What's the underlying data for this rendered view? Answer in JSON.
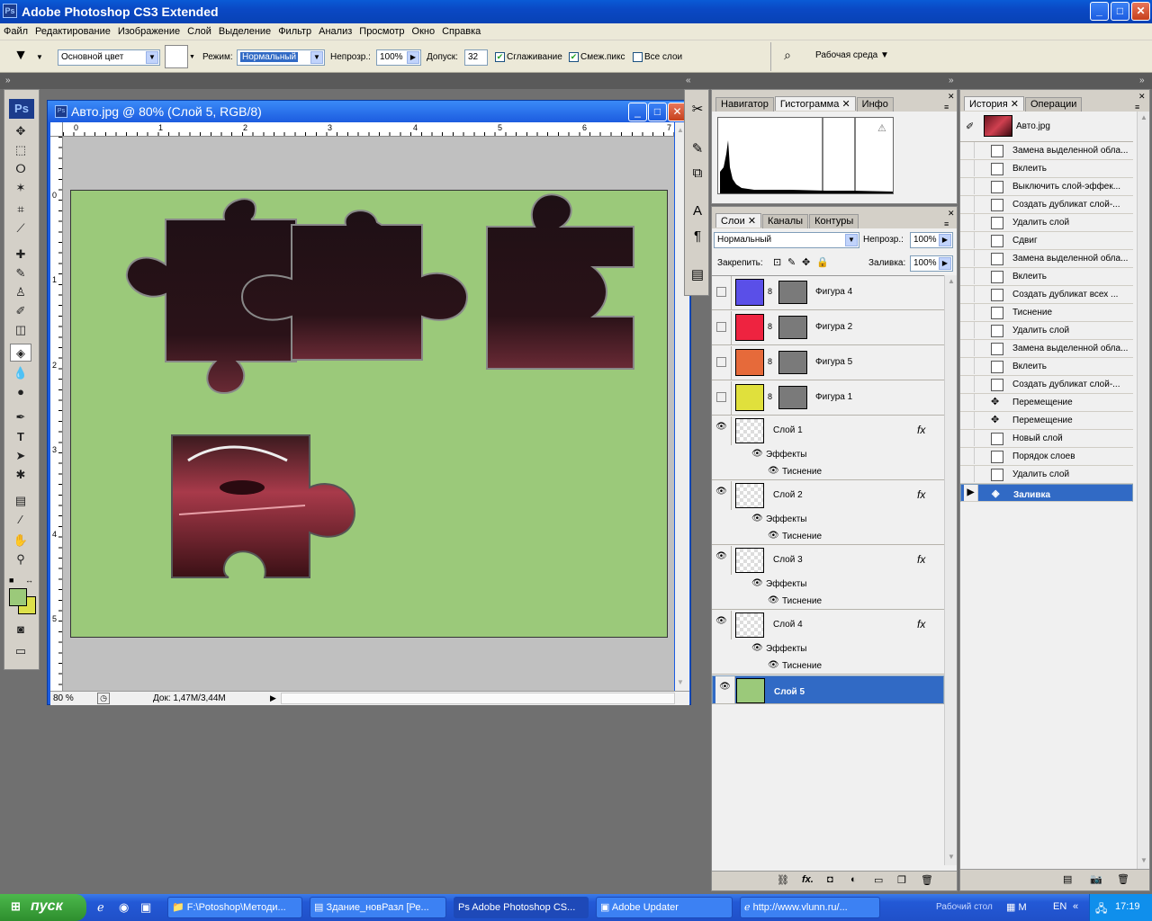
{
  "app": {
    "title": "Adobe Photoshop CS3 Extended",
    "ps_badge": "Ps"
  },
  "window_buttons": {
    "minimize": "_",
    "maximize": "□",
    "close": "✕"
  },
  "menu": [
    "Файл",
    "Редактирование",
    "Изображение",
    "Слой",
    "Выделение",
    "Фильтр",
    "Анализ",
    "Просмотр",
    "Окно",
    "Справка"
  ],
  "options": {
    "fill_source": "Основной цвет",
    "mode_label": "Режим:",
    "mode_value": "Нормальный",
    "opacity_label": "Непрозр.:",
    "opacity_value": "100%",
    "tolerance_label": "Допуск:",
    "tolerance_value": "32",
    "antialias_label": "Сглаживание",
    "contiguous_label": "Смеж.пикс",
    "all_layers_label": "Все слои",
    "workspace_label": "Рабочая среда"
  },
  "document": {
    "title": "Авто.jpg @ 80% (Слой 5, RGB/8)",
    "zoom": "80 %",
    "doc_info": "Док: 1,47M/3,44M",
    "ruler_top": [
      "0",
      "1",
      "2",
      "3",
      "4",
      "5",
      "6",
      "7"
    ],
    "ruler_left": [
      "0",
      "1",
      "2",
      "3",
      "4",
      "5"
    ],
    "canvas_color": "#9bc97a"
  },
  "navigator": {
    "tabs": [
      "Навигатор",
      "Гистограмма",
      "Инфо"
    ],
    "active_tab": "Гистограмма"
  },
  "layers_panel": {
    "tabs": [
      "Слои",
      "Каналы",
      "Контуры"
    ],
    "blend_mode": "Нормальный",
    "opacity_label": "Непрозр.:",
    "opacity_value": "100%",
    "lock_label": "Закрепить:",
    "fill_label": "Заливка:",
    "fill_value": "100%",
    "fx_label": "fx",
    "effects_label": "Эффекты",
    "emboss_label": "Тиснение",
    "shapes": [
      {
        "name": "Фигура 4",
        "color": "#5a4fe8"
      },
      {
        "name": "Фигура 2",
        "color": "#ee2340"
      },
      {
        "name": "Фигура 5",
        "color": "#e66a3a"
      },
      {
        "name": "Фигура 1",
        "color": "#e0e03c"
      }
    ],
    "layers": [
      "Слой 1",
      "Слой 2",
      "Слой 3",
      "Слой 4"
    ],
    "selected_layer": "Слой 5"
  },
  "history_panel": {
    "tabs": [
      "История",
      "Операции"
    ],
    "snapshot": "Авто.jpg",
    "items": [
      "Замена выделенной обла...",
      "Вклеить",
      "Выключить слой-эффек...",
      "Создать дубликат слой-...",
      "Удалить слой",
      "Сдвиг",
      "Замена выделенной обла...",
      "Вклеить",
      "Создать дубликат всех ...",
      "Тиснение",
      "Удалить слой",
      "Замена выделенной обла...",
      "Вклеить",
      "Создать дубликат слой-...",
      "Перемещение",
      "Перемещение",
      "Новый слой",
      "Порядок слоев",
      "Удалить слой"
    ],
    "current": "Заливка"
  },
  "taskbar": {
    "start": "пуск",
    "tasks": [
      "F:\\Potoshop\\Методи...",
      "Здание_новРазл [Ре...",
      "Adobe Photoshop CS...",
      "Adobe Updater",
      "http://www.vlunn.ru/..."
    ],
    "active_task": "Adobe Photoshop CS...",
    "desktop_label": "Рабочий стол",
    "lang": "EN",
    "clock": "17:19"
  }
}
